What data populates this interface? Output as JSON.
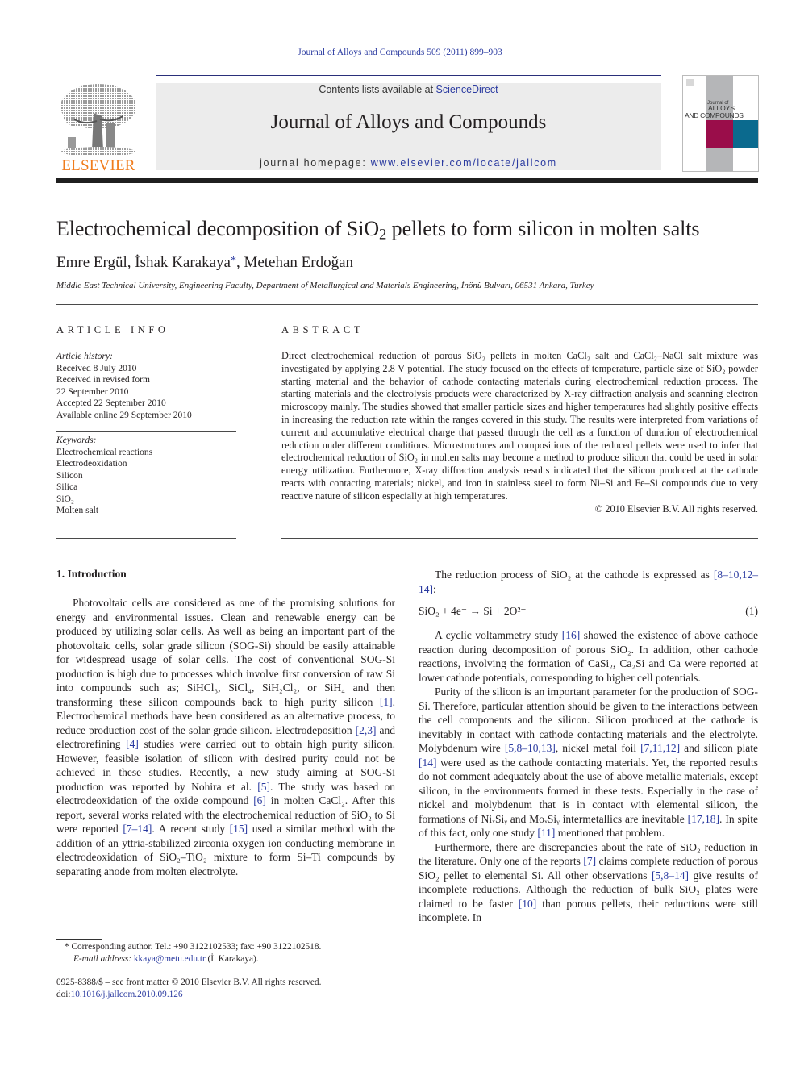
{
  "header": {
    "running_head": "Journal of Alloys and Compounds 509 (2011) 899–903",
    "contents_prefix": "Contents lists available at ",
    "contents_link": "ScienceDirect",
    "journal_title": "Journal of Alloys and Compounds",
    "homepage_prefix": "journal homepage: ",
    "homepage_link": "www.elsevier.com/locate/jallcom",
    "publisher_logo": "ELSEVIER",
    "cover": {
      "small": "Journal of",
      "line1": "ALLOYS",
      "line2": "AND COMPOUNDS",
      "colors": {
        "gray": "#b5b6b8",
        "red": "#9a0d4a",
        "blue": "#0b6a8e"
      }
    },
    "colors": {
      "link": "#2a3aa0",
      "elsevier_orange": "#f07c1c",
      "banner": "#ececec"
    }
  },
  "article": {
    "title_pre": "Electrochemical decomposition of SiO",
    "title_sub": "2",
    "title_post": " pellets to form silicon in molten salts",
    "authors": [
      {
        "name": "Emre Ergül",
        "corresponding": false
      },
      {
        "name": "İshak Karakaya",
        "corresponding": true
      },
      {
        "name": "Metehan Erdoğan",
        "corresponding": false
      }
    ],
    "author_sep": ", ",
    "star": "*",
    "affiliation": "Middle East Technical University, Engineering Faculty, Department of Metallurgical and Materials Engineering, İnönü Bulvarı, 06531 Ankara, Turkey"
  },
  "article_info": {
    "heading": "ARTICLE INFO",
    "history_label": "Article history:",
    "history": [
      "Received 8 July 2010",
      "Received in revised form",
      "22 September 2010",
      "Accepted 22 September 2010",
      "Available online 29 September 2010"
    ],
    "keywords_label": "Keywords:",
    "keywords": [
      "Electrochemical reactions",
      "Electrodeoxidation",
      "Silicon",
      "Silica",
      "SiO₂",
      "Molten salt"
    ]
  },
  "abstract": {
    "heading": "ABSTRACT",
    "text": "Direct electrochemical reduction of porous SiO₂ pellets in molten CaCl₂ salt and CaCl₂–NaCl salt mixture was investigated by applying 2.8 V potential. The study focused on the effects of temperature, particle size of SiO₂ powder starting material and the behavior of cathode contacting materials during electrochemical reduction process. The starting materials and the electrolysis products were characterized by X-ray diffraction analysis and scanning electron microscopy mainly. The studies showed that smaller particle sizes and higher temperatures had slightly positive effects in increasing the reduction rate within the ranges covered in this study. The results were interpreted from variations of current and accumulative electrical charge that passed through the cell as a function of duration of electrochemical reduction under different conditions. Microstructures and compositions of the reduced pellets were used to infer that electrochemical reduction of SiO₂ in molten salts may become a method to produce silicon that could be used in solar energy utilization. Furthermore, X-ray diffraction analysis results indicated that the silicon produced at the cathode reacts with contacting materials; nickel, and iron in stainless steel to form Ni–Si and Fe–Si compounds due to very reactive nature of silicon especially at high temperatures.",
    "copyright": "© 2010 Elsevier B.V. All rights reserved."
  },
  "introduction": {
    "heading": "1.  Introduction",
    "p1": [
      {
        "t": "Photovoltaic cells are considered as one of the promising solutions for energy and environmental issues. Clean and renewable energy can be produced by utilizing solar cells. As well as being an important part of the photovoltaic cells, solar grade silicon (SOG-Si) should be easily attainable for widespread usage of solar cells. The cost of conventional SOG-Si production is high due to processes which involve first conversion of raw Si into compounds such as; SiHCl₃, SiCl₄, SiH₂Cl₂, or SiH₄ and then transforming these silicon compounds back to high purity silicon "
      },
      {
        "c": "[1]"
      },
      {
        "t": ". Electrochemical methods have been considered as an alternative process, to reduce production cost of the solar grade silicon. Electrodeposition "
      },
      {
        "c": "[2,3]"
      },
      {
        "t": " and electrorefining "
      },
      {
        "c": "[4]"
      },
      {
        "t": " studies were carried out to obtain high purity silicon. However, feasible isolation of silicon with desired purity could not be achieved in these studies. Recently, a new study aiming at SOG-Si production was reported by Nohira et al. "
      },
      {
        "c": "[5]"
      },
      {
        "t": ". The study was based on electrodeoxidation of the oxide compound "
      },
      {
        "c": "[6]"
      },
      {
        "t": " in molten CaCl₂. After this report, several works related with the electrochemical reduction of SiO₂ to Si were reported "
      },
      {
        "c": "[7–14]"
      },
      {
        "t": ". A recent study "
      },
      {
        "c": "[15]"
      },
      {
        "t": " used a similar method with the addition of an yttria-stabilized zirconia oxygen ion conducting membrane in electrodeoxidation of SiO₂–TiO₂ mixture to form Si–Ti compounds by separating anode from molten electrolyte."
      }
    ],
    "p2": [
      {
        "t": "The reduction process of SiO₂ at the cathode is expressed as "
      },
      {
        "c": "[8–10,12–14]"
      },
      {
        "t": ":"
      }
    ],
    "equation": "SiO₂ + 4e⁻ →  Si + 2O²⁻",
    "equation_number": "(1)",
    "p3": [
      {
        "t": "A cyclic voltammetry study "
      },
      {
        "c": "[16]"
      },
      {
        "t": " showed the existence of above cathode reaction during decomposition of porous SiO₂. In addition, other cathode reactions, involving the formation of CaSi₂, Ca₂Si and Ca were reported at lower cathode potentials, corresponding to higher cell potentials."
      }
    ],
    "p4": [
      {
        "t": "Purity of the silicon is an important parameter for the production of SOG-Si. Therefore, particular attention should be given to the interactions between the cell components and the silicon. Silicon produced at the cathode is inevitably in contact with cathode contacting materials and the electrolyte. Molybdenum wire "
      },
      {
        "c": "[5,8–10,13]"
      },
      {
        "t": ", nickel metal foil "
      },
      {
        "c": "[7,11,12]"
      },
      {
        "t": " and silicon plate "
      },
      {
        "c": "[14]"
      },
      {
        "t": " were used as the cathode contacting materials. Yet, the reported results do not comment adequately about the use of above metallic materials, except silicon, in the environments formed in these tests. Especially in the case of nickel and molybdenum that is in contact with elemental silicon, the formations of NiₓSiᵧ and MoₓSiᵧ intermetallics are inevitable "
      },
      {
        "c": "[17,18]"
      },
      {
        "t": ". In spite of this fact, only one study "
      },
      {
        "c": "[11]"
      },
      {
        "t": " mentioned that problem."
      }
    ],
    "p5": [
      {
        "t": "Furthermore, there are discrepancies about the rate of SiO₂ reduction in the literature. Only one of the reports "
      },
      {
        "c": "[7]"
      },
      {
        "t": " claims complete reduction of porous SiO₂ pellet to elemental Si. All other observations "
      },
      {
        "c": "[5,8–14]"
      },
      {
        "t": " give results of incomplete reductions. Although the reduction of bulk SiO₂ plates were claimed to be faster "
      },
      {
        "c": "[10]"
      },
      {
        "t": " than porous pellets, their reductions were still incomplete. In"
      }
    ]
  },
  "footnote": {
    "corresponding": "* Corresponding author. Tel.: +90 3122102533; fax: +90 3122102518.",
    "email_label": "E-mail address: ",
    "email": "kkaya@metu.edu.tr",
    "email_suffix": " (İ. Karakaya).",
    "issn_line": "0925-8388/$ – see front matter © 2010 Elsevier B.V. All rights reserved.",
    "doi_prefix": "doi:",
    "doi": "10.1016/j.jallcom.2010.09.126"
  }
}
